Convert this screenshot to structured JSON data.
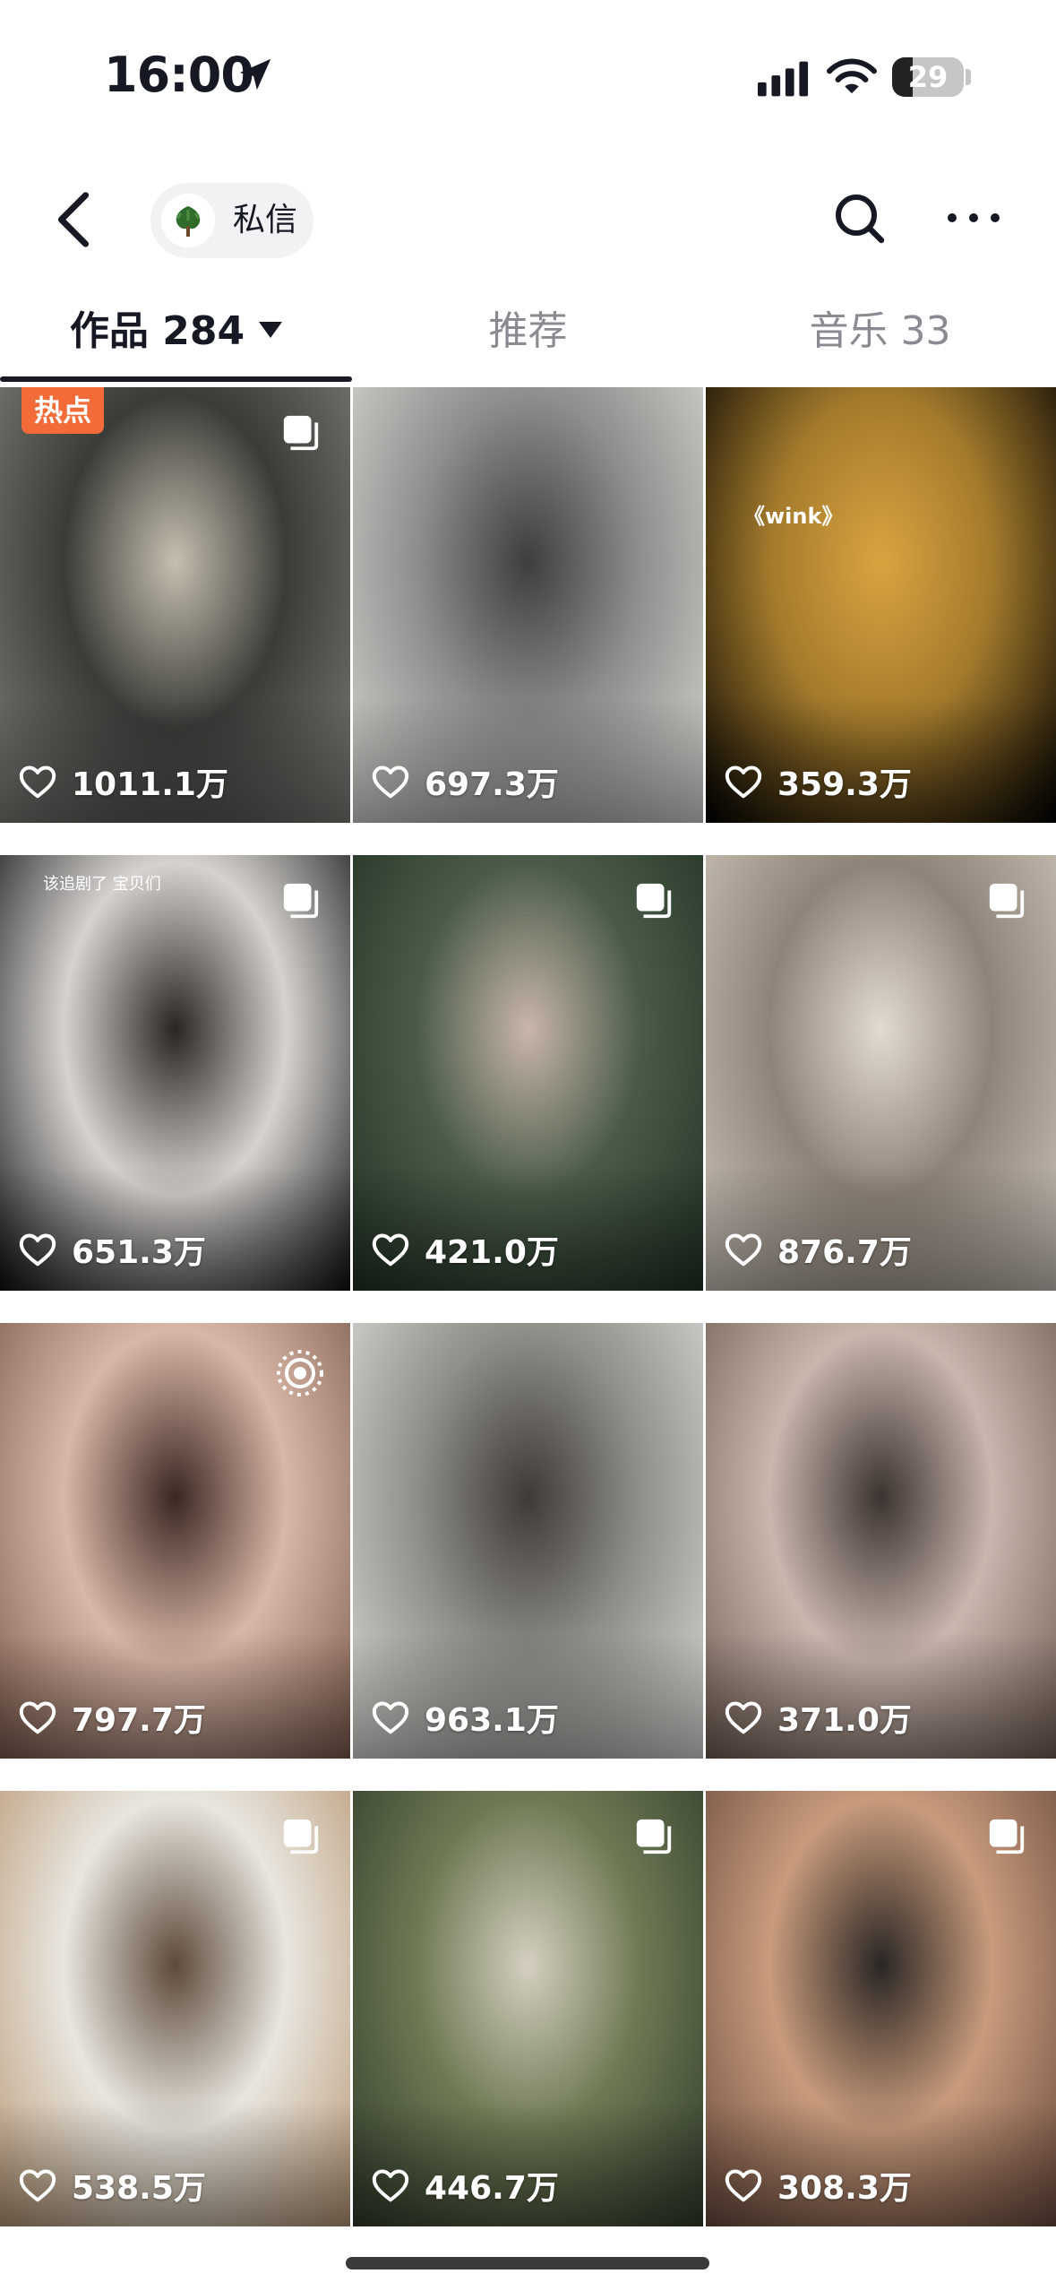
{
  "status_bar": {
    "time": "16:00",
    "battery": "29",
    "battery_level_fraction": 0.29,
    "icons": [
      "location-arrow-icon",
      "signal-icon",
      "wifi-icon",
      "battery-icon"
    ]
  },
  "header": {
    "back_icon": "chevron-left-icon",
    "dm_label": "私信",
    "search_icon": "search-icon",
    "more_icon": "more-icon"
  },
  "tabs": {
    "works": "作品 284",
    "recommend": "推荐",
    "music": "音乐 33"
  },
  "grid": {
    "items": [
      {
        "likes": "1011.1万",
        "badge": "热点",
        "multi": true,
        "colors": [
          "#7d7f78",
          "#3a3c38",
          "#c7bfb0"
        ]
      },
      {
        "likes": "697.3万",
        "multi": false,
        "colors": [
          "#d9d8d4",
          "#8e8f8c",
          "#3d3f3c"
        ]
      },
      {
        "likes": "359.3万",
        "overlay_text": "《wink》",
        "multi": false,
        "colors": [
          "#000000",
          "#a37a2c",
          "#d9a43f"
        ]
      },
      {
        "likes": "651.3万",
        "caption": "该追剧了 宝贝们",
        "multi": true,
        "colors": [
          "#0e0e0e",
          "#d6d3cf",
          "#2a2523"
        ]
      },
      {
        "likes": "421.0万",
        "multi": true,
        "colors": [
          "#203023",
          "#4a5c48",
          "#c9b6aa"
        ]
      },
      {
        "likes": "876.7万",
        "multi": true,
        "colors": [
          "#cfc6bd",
          "#8f8479",
          "#e3dad1"
        ]
      },
      {
        "likes": "797.7万",
        "live": true,
        "colors": [
          "#7a5a4c",
          "#d9b7a8",
          "#3b2822"
        ]
      },
      {
        "likes": "963.1万",
        "multi": false,
        "colors": [
          "#dcdcd8",
          "#8f8f8a",
          "#3f3a36"
        ]
      },
      {
        "likes": "371.0万",
        "multi": false,
        "colors": [
          "#6f5c52",
          "#c9b6ad",
          "#3c3330"
        ]
      },
      {
        "likes": "538.5万",
        "multi": true,
        "colors": [
          "#b89775",
          "#e9e6df",
          "#5d4a3a"
        ]
      },
      {
        "likes": "446.7万",
        "multi": true,
        "colors": [
          "#2f3a2a",
          "#6e7a55",
          "#d5cfc0"
        ]
      },
      {
        "likes": "308.3万",
        "multi": true,
        "colors": [
          "#6a4a3e",
          "#c99b7c",
          "#2a2624"
        ]
      }
    ]
  },
  "colors": {
    "text_primary": "#161823",
    "text_secondary": "#8a8b91",
    "hot_badge": "#f26b38"
  }
}
